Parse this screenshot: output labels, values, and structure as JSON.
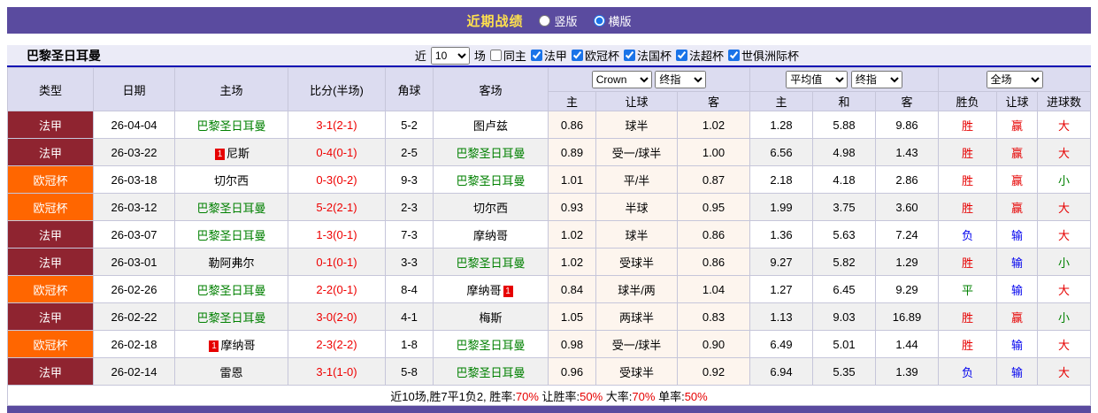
{
  "colors": {
    "topbar_bg": "#5a4b9f",
    "title_text": "#ffe14d",
    "filter_bg": "#ebebf7",
    "divider_blue": "#1414b4",
    "header_bg": "#dcdcf0",
    "row_alt_bg": "#f0f0f0",
    "league_ligue1_bg": "#8f2430",
    "league_ucl_bg": "#ff6600",
    "team_green": "#008000",
    "score_red": "#ee0000",
    "win_red": "#e60000",
    "lose_blue": "#0000ee",
    "draw_green": "#008000",
    "odds_bg": "#fdf5ee"
  },
  "top": {
    "title": "近期战绩",
    "vertical_label": "竖版",
    "horizontal_label": "横版",
    "selected": "横版"
  },
  "filter": {
    "team": "巴黎圣日耳曼",
    "near_label": "近",
    "count_value": "10",
    "games_label": "场",
    "same_home_label": "同主",
    "leagues": [
      "法甲",
      "欧冠杯",
      "法国杯",
      "法超杯",
      "世俱洲际杯"
    ]
  },
  "table": {
    "col_headers": {
      "type": "类型",
      "date": "日期",
      "home": "主场",
      "score": "比分(半场)",
      "corner": "角球",
      "away": "客场",
      "odds_company_select": "Crown",
      "odds_time_select": "终指",
      "odds_sub": [
        "主",
        "让球",
        "客"
      ],
      "avg_select": "平均值",
      "avg_time_select": "终指",
      "avg_sub": [
        "主",
        "和",
        "客"
      ],
      "scope_select": "全场",
      "result_sub": [
        "胜负",
        "让球",
        "进球数"
      ]
    },
    "rows": [
      {
        "league": "法甲",
        "league_type": "ligue1",
        "date": "26-04-04",
        "home": {
          "name": "巴黎圣日耳曼",
          "green": true,
          "card_pre": "",
          "card_post": ""
        },
        "score": "3-1(2-1)",
        "corner": "5-2",
        "away": {
          "name": "图卢兹",
          "green": false,
          "card_pre": "",
          "card_post": ""
        },
        "odds": [
          "0.86",
          "球半",
          "1.02"
        ],
        "avg": [
          "1.28",
          "5.88",
          "9.86"
        ],
        "results": [
          {
            "t": "胜",
            "c": "r"
          },
          {
            "t": "赢",
            "c": "r"
          },
          {
            "t": "大",
            "c": "r"
          }
        ]
      },
      {
        "league": "法甲",
        "league_type": "ligue1",
        "date": "26-03-22",
        "home": {
          "name": "尼斯",
          "green": false,
          "card_pre": "1",
          "card_post": ""
        },
        "score": "0-4(0-1)",
        "corner": "2-5",
        "away": {
          "name": "巴黎圣日耳曼",
          "green": true,
          "card_pre": "",
          "card_post": ""
        },
        "odds": [
          "0.89",
          "受一/球半",
          "1.00"
        ],
        "avg": [
          "6.56",
          "4.98",
          "1.43"
        ],
        "results": [
          {
            "t": "胜",
            "c": "r"
          },
          {
            "t": "赢",
            "c": "r"
          },
          {
            "t": "大",
            "c": "r"
          }
        ]
      },
      {
        "league": "欧冠杯",
        "league_type": "ucl",
        "date": "26-03-18",
        "home": {
          "name": "切尔西",
          "green": false,
          "card_pre": "",
          "card_post": ""
        },
        "score": "0-3(0-2)",
        "corner": "9-3",
        "away": {
          "name": "巴黎圣日耳曼",
          "green": true,
          "card_pre": "",
          "card_post": ""
        },
        "odds": [
          "1.01",
          "平/半",
          "0.87"
        ],
        "avg": [
          "2.18",
          "4.18",
          "2.86"
        ],
        "results": [
          {
            "t": "胜",
            "c": "r"
          },
          {
            "t": "赢",
            "c": "r"
          },
          {
            "t": "小",
            "c": "g"
          }
        ]
      },
      {
        "league": "欧冠杯",
        "league_type": "ucl",
        "date": "26-03-12",
        "home": {
          "name": "巴黎圣日耳曼",
          "green": true,
          "card_pre": "",
          "card_post": ""
        },
        "score": "5-2(2-1)",
        "corner": "2-3",
        "away": {
          "name": "切尔西",
          "green": false,
          "card_pre": "",
          "card_post": ""
        },
        "odds": [
          "0.93",
          "半球",
          "0.95"
        ],
        "avg": [
          "1.99",
          "3.75",
          "3.60"
        ],
        "results": [
          {
            "t": "胜",
            "c": "r"
          },
          {
            "t": "赢",
            "c": "r"
          },
          {
            "t": "大",
            "c": "r"
          }
        ]
      },
      {
        "league": "法甲",
        "league_type": "ligue1",
        "date": "26-03-07",
        "home": {
          "name": "巴黎圣日耳曼",
          "green": true,
          "card_pre": "",
          "card_post": ""
        },
        "score": "1-3(0-1)",
        "corner": "7-3",
        "away": {
          "name": "摩纳哥",
          "green": false,
          "card_pre": "",
          "card_post": ""
        },
        "odds": [
          "1.02",
          "球半",
          "0.86"
        ],
        "avg": [
          "1.36",
          "5.63",
          "7.24"
        ],
        "results": [
          {
            "t": "负",
            "c": "b"
          },
          {
            "t": "输",
            "c": "b"
          },
          {
            "t": "大",
            "c": "r"
          }
        ]
      },
      {
        "league": "法甲",
        "league_type": "ligue1",
        "date": "26-03-01",
        "home": {
          "name": "勒阿弗尔",
          "green": false,
          "card_pre": "",
          "card_post": ""
        },
        "score": "0-1(0-1)",
        "corner": "3-3",
        "away": {
          "name": "巴黎圣日耳曼",
          "green": true,
          "card_pre": "",
          "card_post": ""
        },
        "odds": [
          "1.02",
          "受球半",
          "0.86"
        ],
        "avg": [
          "9.27",
          "5.82",
          "1.29"
        ],
        "results": [
          {
            "t": "胜",
            "c": "r"
          },
          {
            "t": "输",
            "c": "b"
          },
          {
            "t": "小",
            "c": "g"
          }
        ]
      },
      {
        "league": "欧冠杯",
        "league_type": "ucl",
        "date": "26-02-26",
        "home": {
          "name": "巴黎圣日耳曼",
          "green": true,
          "card_pre": "",
          "card_post": ""
        },
        "score": "2-2(0-1)",
        "corner": "8-4",
        "away": {
          "name": "摩纳哥",
          "green": false,
          "card_pre": "",
          "card_post": "1"
        },
        "odds": [
          "0.84",
          "球半/两",
          "1.04"
        ],
        "avg": [
          "1.27",
          "6.45",
          "9.29"
        ],
        "results": [
          {
            "t": "平",
            "c": "g"
          },
          {
            "t": "输",
            "c": "b"
          },
          {
            "t": "大",
            "c": "r"
          }
        ]
      },
      {
        "league": "法甲",
        "league_type": "ligue1",
        "date": "26-02-22",
        "home": {
          "name": "巴黎圣日耳曼",
          "green": true,
          "card_pre": "",
          "card_post": ""
        },
        "score": "3-0(2-0)",
        "corner": "4-1",
        "away": {
          "name": "梅斯",
          "green": false,
          "card_pre": "",
          "card_post": ""
        },
        "odds": [
          "1.05",
          "两球半",
          "0.83"
        ],
        "avg": [
          "1.13",
          "9.03",
          "16.89"
        ],
        "results": [
          {
            "t": "胜",
            "c": "r"
          },
          {
            "t": "赢",
            "c": "r"
          },
          {
            "t": "小",
            "c": "g"
          }
        ]
      },
      {
        "league": "欧冠杯",
        "league_type": "ucl",
        "date": "26-02-18",
        "home": {
          "name": "摩纳哥",
          "green": false,
          "card_pre": "1",
          "card_post": ""
        },
        "score": "2-3(2-2)",
        "corner": "1-8",
        "away": {
          "name": "巴黎圣日耳曼",
          "green": true,
          "card_pre": "",
          "card_post": ""
        },
        "odds": [
          "0.98",
          "受一/球半",
          "0.90"
        ],
        "avg": [
          "6.49",
          "5.01",
          "1.44"
        ],
        "results": [
          {
            "t": "胜",
            "c": "r"
          },
          {
            "t": "输",
            "c": "b"
          },
          {
            "t": "大",
            "c": "r"
          }
        ]
      },
      {
        "league": "法甲",
        "league_type": "ligue1",
        "date": "26-02-14",
        "home": {
          "name": "雷恩",
          "green": false,
          "card_pre": "",
          "card_post": ""
        },
        "score": "3-1(1-0)",
        "corner": "5-8",
        "away": {
          "name": "巴黎圣日耳曼",
          "green": true,
          "card_pre": "",
          "card_post": ""
        },
        "odds": [
          "0.96",
          "受球半",
          "0.92"
        ],
        "avg": [
          "6.94",
          "5.35",
          "1.39"
        ],
        "results": [
          {
            "t": "负",
            "c": "b"
          },
          {
            "t": "输",
            "c": "b"
          },
          {
            "t": "大",
            "c": "r"
          }
        ]
      }
    ]
  },
  "summary": {
    "segments": [
      {
        "text": "近10场,胜7平1负2, 胜率:",
        "color": "k"
      },
      {
        "text": "70%",
        "color": "r"
      },
      {
        "text": " 让胜率:",
        "color": "k"
      },
      {
        "text": "50%",
        "color": "r"
      },
      {
        "text": " 大率:",
        "color": "k"
      },
      {
        "text": "70%",
        "color": "r"
      },
      {
        "text": " 单率:",
        "color": "k"
      },
      {
        "text": "50%",
        "color": "r"
      }
    ]
  }
}
